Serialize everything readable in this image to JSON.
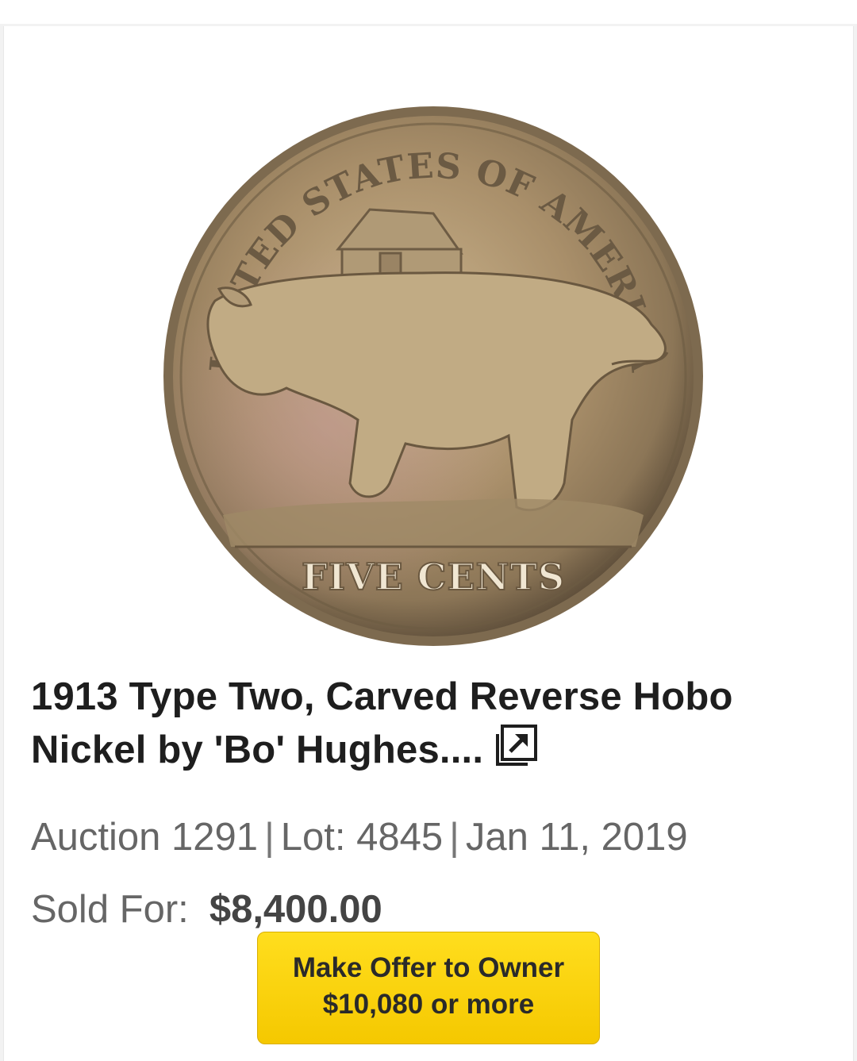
{
  "listing": {
    "image_alt": "Hobo nickel coin reverse",
    "coin_inscriptions": {
      "top": "UNITED STATES OF AMERICA",
      "bottom": "FIVE CENTS"
    },
    "title": "1913 Type Two, Carved Reverse Hobo Nickel by 'Bo' Hughes....",
    "title_icon": "external-link-icon",
    "auction": "Auction 1291",
    "lot": "Lot: 4845",
    "date": "Jan 11, 2019",
    "sold_label": "Sold For:",
    "sold_price": "$8,400.00"
  },
  "offer_button": {
    "line1": "Make Offer to Owner",
    "line2": "$10,080 or more",
    "color": "#f7cf0a"
  }
}
